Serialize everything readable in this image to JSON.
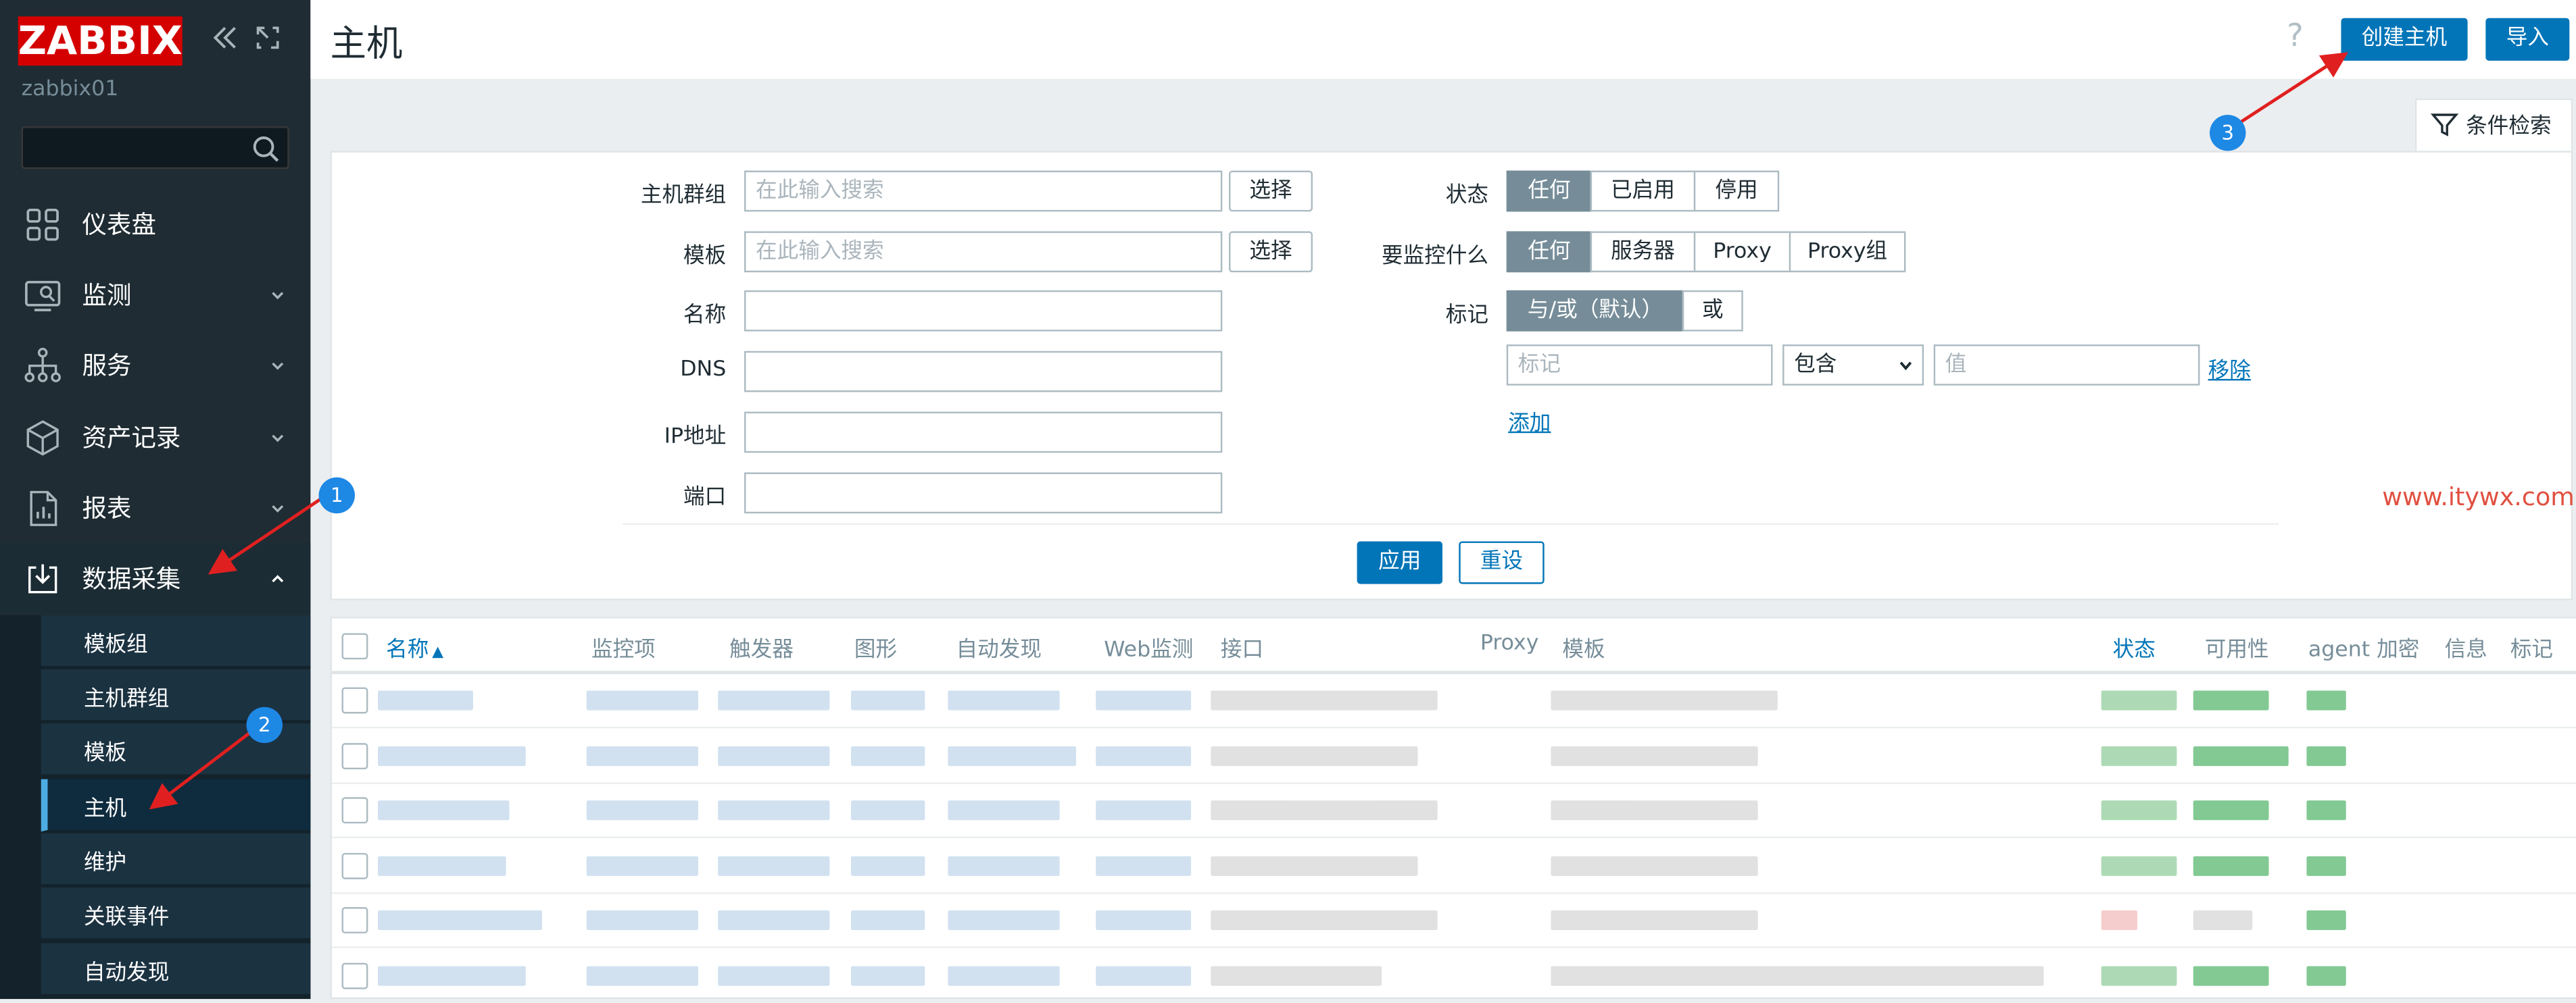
{
  "sidebar": {
    "logo": "ZABBIX",
    "server_name": "zabbix01",
    "search_placeholder": "",
    "menu": [
      {
        "label": "仪表盘",
        "icon": "dashboard-icon"
      },
      {
        "label": "监测",
        "icon": "monitoring-icon"
      },
      {
        "label": "服务",
        "icon": "services-icon"
      },
      {
        "label": "资产记录",
        "icon": "inventory-icon"
      },
      {
        "label": "报表",
        "icon": "reports-icon"
      },
      {
        "label": "数据采集",
        "icon": "data-collection-icon"
      }
    ],
    "submenu": [
      "模板组",
      "主机群组",
      "模板",
      "主机",
      "维护",
      "关联事件",
      "自动发现"
    ]
  },
  "header": {
    "title": "主机",
    "help": "?",
    "create_host_label": "创建主机",
    "import_label": "导入"
  },
  "filter": {
    "tab_label": "条件检索",
    "host_groups_label": "主机群组",
    "host_groups_placeholder": "在此输入搜索",
    "templates_label": "模板",
    "templates_placeholder": "在此输入搜索",
    "select_label": "选择",
    "name_label": "名称",
    "dns_label": "DNS",
    "ip_label": "IP地址",
    "port_label": "端口",
    "status_label": "状态",
    "status_options": [
      "任何",
      "已启用",
      "停用"
    ],
    "monitored_by_label": "要监控什么",
    "monitored_by_options": [
      "任何",
      "服务器",
      "Proxy",
      "Proxy组"
    ],
    "tags_label": "标记",
    "tags_mode_options": [
      "与/或（默认）",
      "或"
    ],
    "tag_placeholder": "标记",
    "tag_operator": "包含",
    "tag_value_placeholder": "值",
    "remove_label": "移除",
    "add_label": "添加",
    "apply_label": "应用",
    "reset_label": "重设"
  },
  "table": {
    "columns": [
      "名称",
      "监控项",
      "触发器",
      "图形",
      "自动发现",
      "Web监测",
      "接口",
      "Proxy",
      "模板",
      "状态",
      "可用性",
      "agent 加密",
      "信息",
      "标记"
    ],
    "sort_indicator": "▲",
    "rows": 6
  },
  "watermark": "www.itywx.com",
  "annotations": [
    "1",
    "2",
    "3"
  ],
  "colors": {
    "sidebar_bg": "#1f2c33",
    "accent_blue": "#0275b8",
    "segment_active": "#768d99",
    "logo_red": "#d40000",
    "annotation_arrow": "#e02020",
    "annotation_badge": "#1e88e5"
  }
}
